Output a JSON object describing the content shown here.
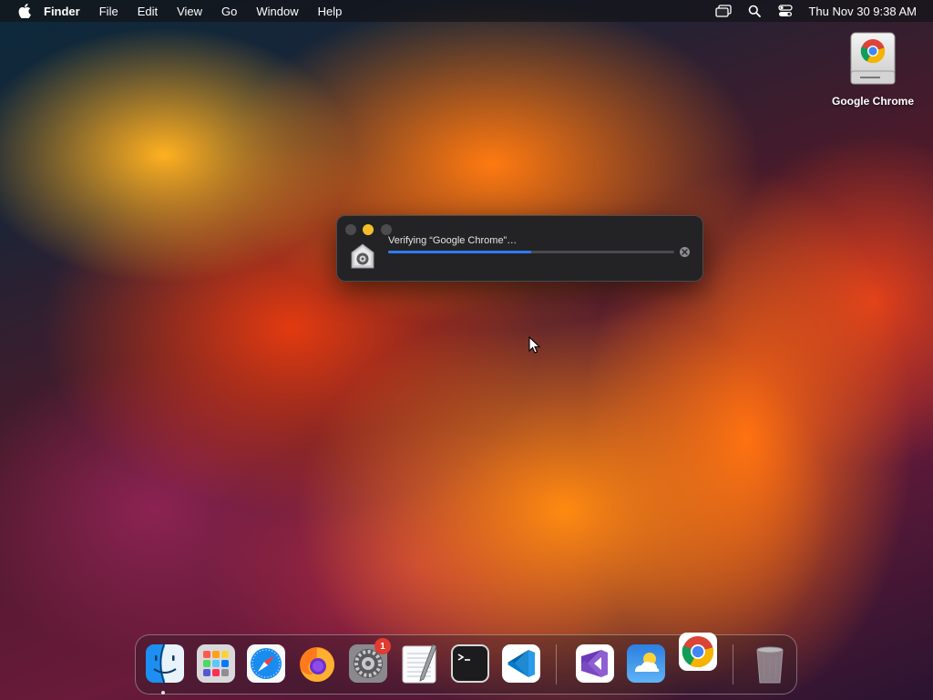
{
  "menubar": {
    "app_name": "Finder",
    "menus": [
      "File",
      "Edit",
      "View",
      "Go",
      "Window",
      "Help"
    ],
    "status_icons": [
      "screen-mirroring-icon",
      "search-icon",
      "control-center-icon"
    ],
    "clock": "Thu Nov 30  9:38 AM"
  },
  "desktop": {
    "icons": [
      {
        "label": "Google Chrome",
        "icon": "chrome-disk-image-icon"
      }
    ]
  },
  "dialog": {
    "message": "Verifying “Google Chrome”…",
    "progress": 0.5,
    "window_controls": [
      "close",
      "minimize",
      "zoom"
    ],
    "icon": "security-shield-icon",
    "colors": {
      "progress": "#2f7bf5",
      "minimize": "#f5bf2b"
    }
  },
  "dock": {
    "apps": [
      {
        "name": "finder-icon",
        "running": true
      },
      {
        "name": "launchpad-icon"
      },
      {
        "name": "safari-icon"
      },
      {
        "name": "firefox-icon"
      },
      {
        "name": "system-settings-icon",
        "badge": "1"
      },
      {
        "name": "textedit-icon"
      },
      {
        "name": "terminal-icon"
      },
      {
        "name": "vscode-icon"
      },
      {
        "name": "visual-studio-icon"
      },
      {
        "name": "weather-icon"
      },
      {
        "name": "chrome-icon"
      },
      {
        "name": "trash-icon"
      }
    ]
  }
}
